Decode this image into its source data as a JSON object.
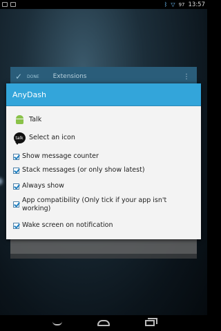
{
  "status_bar": {
    "time": "13:57",
    "battery": "97",
    "left_icons": [
      "talk-notification-icon",
      "android-notification-icon"
    ],
    "right_icons": [
      "bluetooth-icon",
      "wifi-icon",
      "battery-icon"
    ]
  },
  "background_screen": {
    "actionbar_done": "DONE",
    "actionbar_title": "Extensions"
  },
  "dialog": {
    "title": "AnyDash",
    "app_items": [
      {
        "label": "Talk",
        "icon": "android-icon"
      },
      {
        "label": "Select an icon",
        "icon": "talk-icon"
      }
    ],
    "options": [
      {
        "label": "Show message counter",
        "checked": true
      },
      {
        "label": "Stack messages (or only show latest)",
        "checked": true
      },
      {
        "label": "Always show",
        "checked": true
      },
      {
        "label": "App compatibility (Only tick if your app isn't working)",
        "checked": true
      },
      {
        "label": "Wake screen on notification",
        "checked": true
      }
    ]
  },
  "nav_bar": {
    "buttons": [
      "back-icon",
      "home-icon",
      "recent-apps-icon"
    ]
  }
}
